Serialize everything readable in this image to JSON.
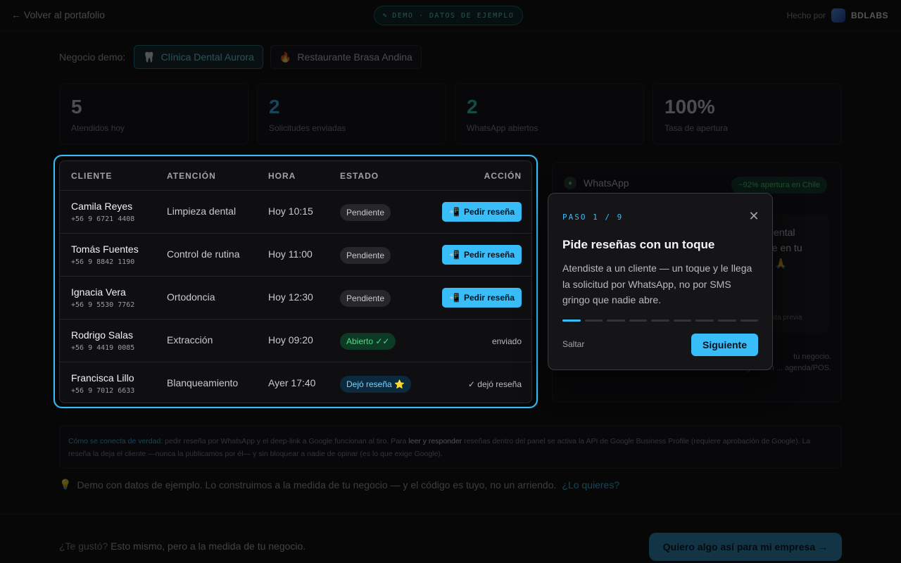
{
  "header": {
    "back_link": "← Volver al portafolio",
    "demo_pill": "DEMO · DATOS DE EJEMPLO",
    "made_by": "Hecho por",
    "brand": "BDLABS"
  },
  "business": {
    "label": "Negocio demo:",
    "options": [
      {
        "icon": "🦷",
        "label": "Clínica Dental Aurora",
        "active": true
      },
      {
        "icon": "🔥",
        "label": "Restaurante Brasa Andina",
        "active": false
      }
    ]
  },
  "stats": [
    {
      "value": "5",
      "label": "Atendidos hoy"
    },
    {
      "value": "2",
      "label": "Solicitudes enviadas"
    },
    {
      "value": "2",
      "label": "WhatsApp abiertos"
    },
    {
      "value": "100%",
      "label": "Tasa de apertura"
    }
  ],
  "table": {
    "headers": {
      "client": "CLIENTE",
      "attention": "ATENCIÓN",
      "hour": "HORA",
      "state": "ESTADO",
      "action": "ACCIÓN"
    },
    "rows": [
      {
        "name": "Camila Reyes",
        "phone": "+56 9 6721 4408",
        "attention": "Limpieza dental",
        "hour": "Hoy 10:15",
        "state": "Pendiente",
        "action": "Pedir reseña"
      },
      {
        "name": "Tomás Fuentes",
        "phone": "+56 9 8842 1190",
        "attention": "Control de rutina",
        "hour": "Hoy 11:00",
        "state": "Pendiente",
        "action": "Pedir reseña"
      },
      {
        "name": "Ignacia Vera",
        "phone": "+56 9 5530 7762",
        "attention": "Ortodoncia",
        "hour": "Hoy 12:30",
        "state": "Pendiente",
        "action": "Pedir reseña"
      },
      {
        "name": "Rodrigo Salas",
        "phone": "+56 9 4419 0085",
        "attention": "Extracción",
        "hour": "Hoy 09:20",
        "state": "Abierto ✓✓",
        "action": "enviado"
      },
      {
        "name": "Francisca Lillo",
        "phone": "+56 9 7012 6633",
        "attention": "Blanqueamiento",
        "hour": "Ayer 17:40",
        "state": "Dejó reseña ⭐",
        "action": "✓ dejó reseña"
      }
    ]
  },
  "whatsapp": {
    "title": "WhatsApp",
    "badge": "~92% apertura en Chile",
    "bubble_lines": [
      "Dental",
      "ue en tu",
      "n 🙏"
    ],
    "preview": "vista previa",
    "note_lines": [
      "tu negocio.",
      "auge ... en ... agenda/POS."
    ]
  },
  "info": {
    "highlight": "Cómo se conecta de verdad:",
    "text_a": " pedir reseña por WhatsApp y el deep-link a Google funcionan al tiro. Para ",
    "strong": "leer y responder",
    "text_b": " reseñas dentro del panel se activa la API de Google Business Profile (requiere aprobación de Google). La reseña la deja el cliente —nunca la publicamos por él— y sin bloquear a nadie de opinar (es lo que exige Google)."
  },
  "footnote": {
    "icon": "💡",
    "text": "Demo con datos de ejemplo. Lo construimos a la medida de tu negocio — y el código es tuyo, no un arriendo.",
    "link": "¿Lo quieres?"
  },
  "footer": {
    "question": "¿Te gustó?",
    "text": "Esto mismo, pero a la medida de tu negocio.",
    "cta": "Quiero algo así para mi empresa →"
  },
  "tour": {
    "step": "PASO 1 / 9",
    "title": "Pide reseñas con un toque",
    "body": "Atendiste a un cliente — un toque y le llega la solicitud por WhatsApp, no por SMS gringo que nadie abre.",
    "current": 1,
    "total": 9,
    "skip": "Saltar",
    "next": "Siguiente"
  },
  "colors": {
    "accent": "#38bdf8",
    "success": "#4ade80",
    "teal": "#2dd4bf"
  }
}
